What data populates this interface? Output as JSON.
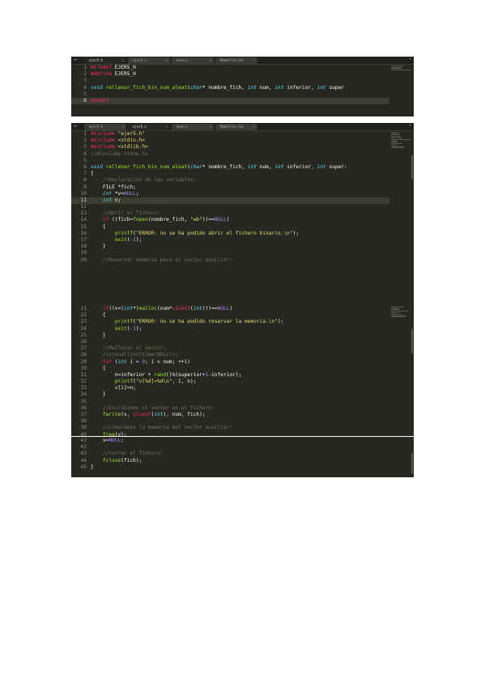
{
  "tabs_shot1": [
    "ejer5.h",
    "ejer5.c",
    "main.c",
    "Makefile.txt"
  ],
  "tabs_shot2": [
    "ejer5.h",
    "ejer5.c",
    "main.c",
    "Makefile.txt"
  ],
  "shot1_lines": [
    {
      "n": "1",
      "p": [
        [
          "k",
          "#ifndef"
        ],
        [
          "",
          ""
        ],
        [
          "txt",
          " EJER5_H"
        ]
      ]
    },
    {
      "n": "2",
      "p": [
        [
          "k",
          "#define"
        ],
        [
          "txt",
          " EJER5_H"
        ]
      ]
    },
    {
      "n": "3",
      "p": []
    },
    {
      "n": "4",
      "p": [
        [
          "t",
          "void"
        ],
        [
          "txt",
          " "
        ],
        [
          "f",
          "rellenar_fich_bin_num_aleat"
        ],
        [
          "txt",
          "("
        ],
        [
          "t",
          "char"
        ],
        [
          "txt",
          "* nombre_fich, "
        ],
        [
          "t",
          "int"
        ],
        [
          "txt",
          " num, "
        ],
        [
          "t",
          "int"
        ],
        [
          "txt",
          " inferior, "
        ],
        [
          "t",
          "int"
        ],
        [
          "txt",
          " super"
        ]
      ]
    },
    {
      "n": "5",
      "p": []
    },
    {
      "n": "6",
      "hl": true,
      "p": [
        [
          "k",
          "#endif"
        ]
      ]
    }
  ],
  "shot2_lines": [
    {
      "n": "1",
      "p": [
        [
          "k",
          "#include"
        ],
        [
          "txt",
          " "
        ],
        [
          "s",
          "\"ejer5.h\""
        ]
      ]
    },
    {
      "n": "2",
      "p": [
        [
          "k",
          "#include"
        ],
        [
          "txt",
          " "
        ],
        [
          "s",
          "<stdio.h>"
        ]
      ]
    },
    {
      "n": "3",
      "p": [
        [
          "k",
          "#include"
        ],
        [
          "txt",
          " "
        ],
        [
          "s",
          "<stdlib.h>"
        ]
      ]
    },
    {
      "n": "4",
      "p": [
        [
          "c",
          "//#include <time.h>"
        ]
      ]
    },
    {
      "n": "5",
      "p": []
    },
    {
      "n": "6",
      "p": [
        [
          "t",
          "void"
        ],
        [
          "txt",
          " "
        ],
        [
          "f",
          "rellenar_fich_bin_num_aleat"
        ],
        [
          "txt",
          "("
        ],
        [
          "t",
          "char"
        ],
        [
          "txt",
          "* nombre_fich, "
        ],
        [
          "t",
          "int"
        ],
        [
          "txt",
          " num, "
        ],
        [
          "t",
          "int"
        ],
        [
          "txt",
          " inferior, "
        ],
        [
          "t",
          "int"
        ],
        [
          "txt",
          " super:"
        ]
      ]
    },
    {
      "n": "7",
      "p": [
        [
          "txt",
          "{"
        ]
      ]
    },
    {
      "n": "8",
      "p": [
        [
          "txt",
          "    "
        ],
        [
          "c",
          "//Declaración de las variables:"
        ]
      ]
    },
    {
      "n": "9",
      "p": [
        [
          "txt",
          "    FILE *fich;"
        ]
      ]
    },
    {
      "n": "10",
      "p": [
        [
          "txt",
          "    "
        ],
        [
          "t",
          "int"
        ],
        [
          "txt",
          " *v="
        ],
        [
          "n",
          "NULL"
        ],
        [
          "txt",
          ";"
        ]
      ]
    },
    {
      "n": "11",
      "hl": true,
      "p": [
        [
          "txt",
          "    "
        ],
        [
          "t",
          "int"
        ],
        [
          "txt",
          " n;"
        ]
      ]
    },
    {
      "n": "12",
      "p": []
    },
    {
      "n": "13",
      "p": [
        [
          "txt",
          "    "
        ],
        [
          "c",
          "//Abrir el fichero:"
        ]
      ]
    },
    {
      "n": "14",
      "p": [
        [
          "txt",
          "    "
        ],
        [
          "k",
          "if"
        ],
        [
          "txt",
          " ((fich="
        ],
        [
          "f",
          "fopen"
        ],
        [
          "txt",
          "(nombre_fich, "
        ],
        [
          "s",
          "\"wb\""
        ],
        [
          "txt",
          "))=="
        ],
        [
          "n",
          "NULL"
        ],
        [
          "txt",
          ")"
        ]
      ]
    },
    {
      "n": "15",
      "p": [
        [
          "txt",
          "    {"
        ]
      ]
    },
    {
      "n": "16",
      "p": [
        [
          "txt",
          "        "
        ],
        [
          "f",
          "printf"
        ],
        [
          "txt",
          "("
        ],
        [
          "s",
          "\"ERROR: no se ha podido abrir el fichero binario.\\n\""
        ],
        [
          "txt",
          ");"
        ]
      ]
    },
    {
      "n": "17",
      "p": [
        [
          "txt",
          "        "
        ],
        [
          "f",
          "exit"
        ],
        [
          "txt",
          "("
        ],
        [
          "n",
          "-1"
        ],
        [
          "txt",
          ");"
        ]
      ]
    },
    {
      "n": "18",
      "p": [
        [
          "txt",
          "    }"
        ]
      ]
    },
    {
      "n": "19",
      "p": []
    },
    {
      "n": "20",
      "p": [
        [
          "txt",
          "    "
        ],
        [
          "c",
          "//Reservar memoria para el vector auxiliar:"
        ]
      ]
    }
  ],
  "shot3_lines": [
    {
      "n": "21",
      "p": [
        [
          "txt",
          "    "
        ],
        [
          "k",
          "if"
        ],
        [
          "txt",
          "((v=("
        ],
        [
          "t",
          "int"
        ],
        [
          "txt",
          "*)"
        ],
        [
          "f",
          "malloc"
        ],
        [
          "txt",
          "(num*"
        ],
        [
          "k",
          "sizeof"
        ],
        [
          "txt",
          "("
        ],
        [
          "t",
          "int"
        ],
        [
          "txt",
          ")))=="
        ],
        [
          "n",
          "NULL"
        ],
        [
          "txt",
          ")"
        ]
      ]
    },
    {
      "n": "22",
      "p": [
        [
          "txt",
          "    {"
        ]
      ]
    },
    {
      "n": "23",
      "p": [
        [
          "txt",
          "        "
        ],
        [
          "f",
          "printf"
        ],
        [
          "txt",
          "("
        ],
        [
          "s",
          "\"ERROR: no se ha podido reservar la memoria.\\n\""
        ],
        [
          "txt",
          ");"
        ]
      ]
    },
    {
      "n": "24",
      "p": [
        [
          "txt",
          "        "
        ],
        [
          "f",
          "exit"
        ],
        [
          "txt",
          "("
        ],
        [
          "n",
          "-1"
        ],
        [
          "txt",
          ");"
        ]
      ]
    },
    {
      "n": "25",
      "p": [
        [
          "txt",
          "    }"
        ]
      ]
    },
    {
      "n": "26",
      "p": []
    },
    {
      "n": "27",
      "p": [
        [
          "txt",
          "    "
        ],
        [
          "c",
          "//Rellenar el vector:"
        ]
      ]
    },
    {
      "n": "28",
      "p": [
        [
          "txt",
          "    "
        ],
        [
          "c",
          "//srand((int)time(NULL));"
        ]
      ]
    },
    {
      "n": "29",
      "p": [
        [
          "txt",
          "    "
        ],
        [
          "k",
          "for"
        ],
        [
          "txt",
          " ("
        ],
        [
          "t",
          "int"
        ],
        [
          "txt",
          " i = "
        ],
        [
          "n",
          "0"
        ],
        [
          "txt",
          "; i < num; ++i)"
        ]
      ]
    },
    {
      "n": "30",
      "p": [
        [
          "txt",
          "    {"
        ]
      ]
    },
    {
      "n": "31",
      "p": [
        [
          "txt",
          "        n=inferior + "
        ],
        [
          "f",
          "rand"
        ],
        [
          "txt",
          "()%(superior+"
        ],
        [
          "n",
          "1"
        ],
        [
          "txt",
          "-inferior);"
        ]
      ]
    },
    {
      "n": "32",
      "p": [
        [
          "txt",
          "        "
        ],
        [
          "f",
          "printf"
        ],
        [
          "txt",
          "("
        ],
        [
          "s",
          "\"v[%d]=%d\\n\""
        ],
        [
          "txt",
          ", i, n);"
        ]
      ]
    },
    {
      "n": "33",
      "p": [
        [
          "txt",
          "        v[i]=n;"
        ]
      ]
    },
    {
      "n": "34",
      "p": [
        [
          "txt",
          "    }"
        ]
      ]
    },
    {
      "n": "35",
      "p": []
    },
    {
      "n": "36",
      "p": [
        [
          "txt",
          "    "
        ],
        [
          "c",
          "//Escribimos el vector en el fichero:"
        ]
      ]
    },
    {
      "n": "37",
      "p": [
        [
          "txt",
          "    "
        ],
        [
          "f",
          "fwrite"
        ],
        [
          "txt",
          "(v, "
        ],
        [
          "k",
          "sizeof"
        ],
        [
          "txt",
          "("
        ],
        [
          "t",
          "int"
        ],
        [
          "txt",
          "), num, fich);"
        ]
      ]
    },
    {
      "n": "38",
      "p": []
    },
    {
      "n": "39",
      "p": [
        [
          "txt",
          "    "
        ],
        [
          "c",
          "//Liberamos la memoria del vector auxiliar:"
        ]
      ]
    },
    {
      "n": "40",
      "p": [
        [
          "txt",
          "    "
        ],
        [
          "f",
          "free"
        ],
        [
          "txt",
          "(v);"
        ]
      ]
    }
  ],
  "shot4_lines": [
    {
      "n": "41",
      "p": [
        [
          "txt",
          "    v="
        ],
        [
          "n",
          "NULL"
        ],
        [
          "txt",
          ";"
        ]
      ]
    },
    {
      "n": "42",
      "p": []
    },
    {
      "n": "43",
      "p": [
        [
          "txt",
          "    "
        ],
        [
          "c",
          "//Cerrar el fichero:"
        ]
      ]
    },
    {
      "n": "44",
      "p": [
        [
          "txt",
          "    "
        ],
        [
          "f",
          "fclose"
        ],
        [
          "txt",
          "(fich);"
        ]
      ]
    },
    {
      "n": "45",
      "p": [
        [
          "txt",
          "}"
        ]
      ]
    }
  ]
}
